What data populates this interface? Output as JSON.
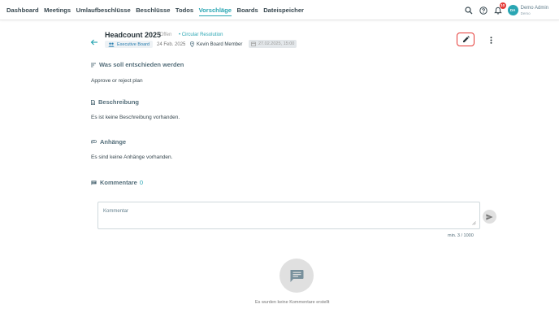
{
  "nav": {
    "items": [
      "Dashboard",
      "Meetings",
      "Umlaufbeschlüsse",
      "Beschlüsse",
      "Todos",
      "Vorschläge",
      "Boards",
      "Dateispeicher"
    ],
    "active_index": 5
  },
  "topbar": {
    "notification_count": "10",
    "avatar_initials": "DA",
    "user_name": "Demo Admin",
    "user_role": "Demo"
  },
  "proposal": {
    "title": "Headcount 2025",
    "status": "• Offen",
    "type": "• Circular Resolution",
    "board_chip": "Executive Board",
    "date": "24 Feb. 2025",
    "person": "Kevin Board Member",
    "deadline": "27.02.2025, 15:00"
  },
  "sections": {
    "decision_heading": "Was soll entschieden werden",
    "decision_text": "Approve or reject plan",
    "description_heading": "Beschreibung",
    "description_text": "Es ist keine Beschreibung vorhanden.",
    "attachments_heading": "Anhänge",
    "attachments_text": "Es sind keine Anhänge vorhanden.",
    "comments_heading": "Kommentare",
    "comments_count": "0"
  },
  "comment": {
    "placeholder": "Kommentar",
    "counter": "min. 3 / 1000",
    "empty_text": "Es wurden keine Kommentare erstellt"
  },
  "colors": {
    "accent": "#2aa6b3",
    "highlight_border": "#e53935"
  }
}
